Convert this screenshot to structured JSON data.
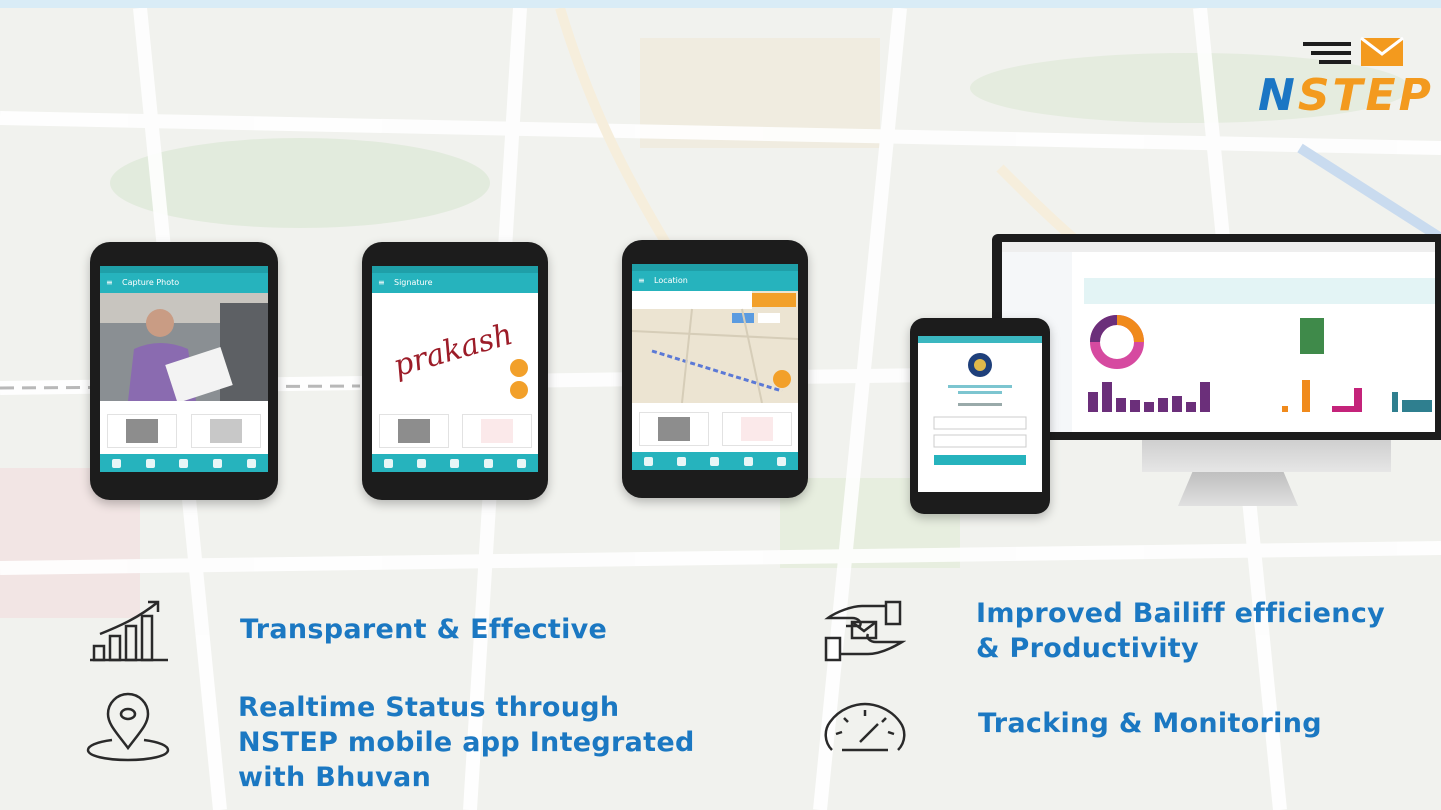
{
  "logo": {
    "first_letter": "N",
    "rest": "STEP",
    "brand_blue": "#1b76c4",
    "brand_orange": "#f39a1e"
  },
  "phones": [
    {
      "title": "Capture Photo",
      "screen": "photo"
    },
    {
      "title": "Signature",
      "screen": "signature",
      "signature_text": "prakash"
    },
    {
      "title": "Location",
      "screen": "map"
    }
  ],
  "small_phone": {
    "screen": "login"
  },
  "features": [
    {
      "icon": "growth-chart-icon",
      "text": "Transparent & Effective"
    },
    {
      "icon": "location-pin-icon",
      "lines": [
        "Realtime Status through",
        "NSTEP mobile app Integrated",
        "with Bhuvan"
      ]
    },
    {
      "icon": "hands-mail-icon",
      "lines": [
        "Improved Bailiff efficiency",
        "& Productivity"
      ]
    },
    {
      "icon": "speedometer-icon",
      "text": "Tracking & Monitoring"
    }
  ],
  "colors": {
    "accent_teal": "#26b3bd",
    "text_blue": "#1b78c2",
    "dashboard_purple": "#6b2f7a",
    "dashboard_orange": "#f08a1c"
  }
}
